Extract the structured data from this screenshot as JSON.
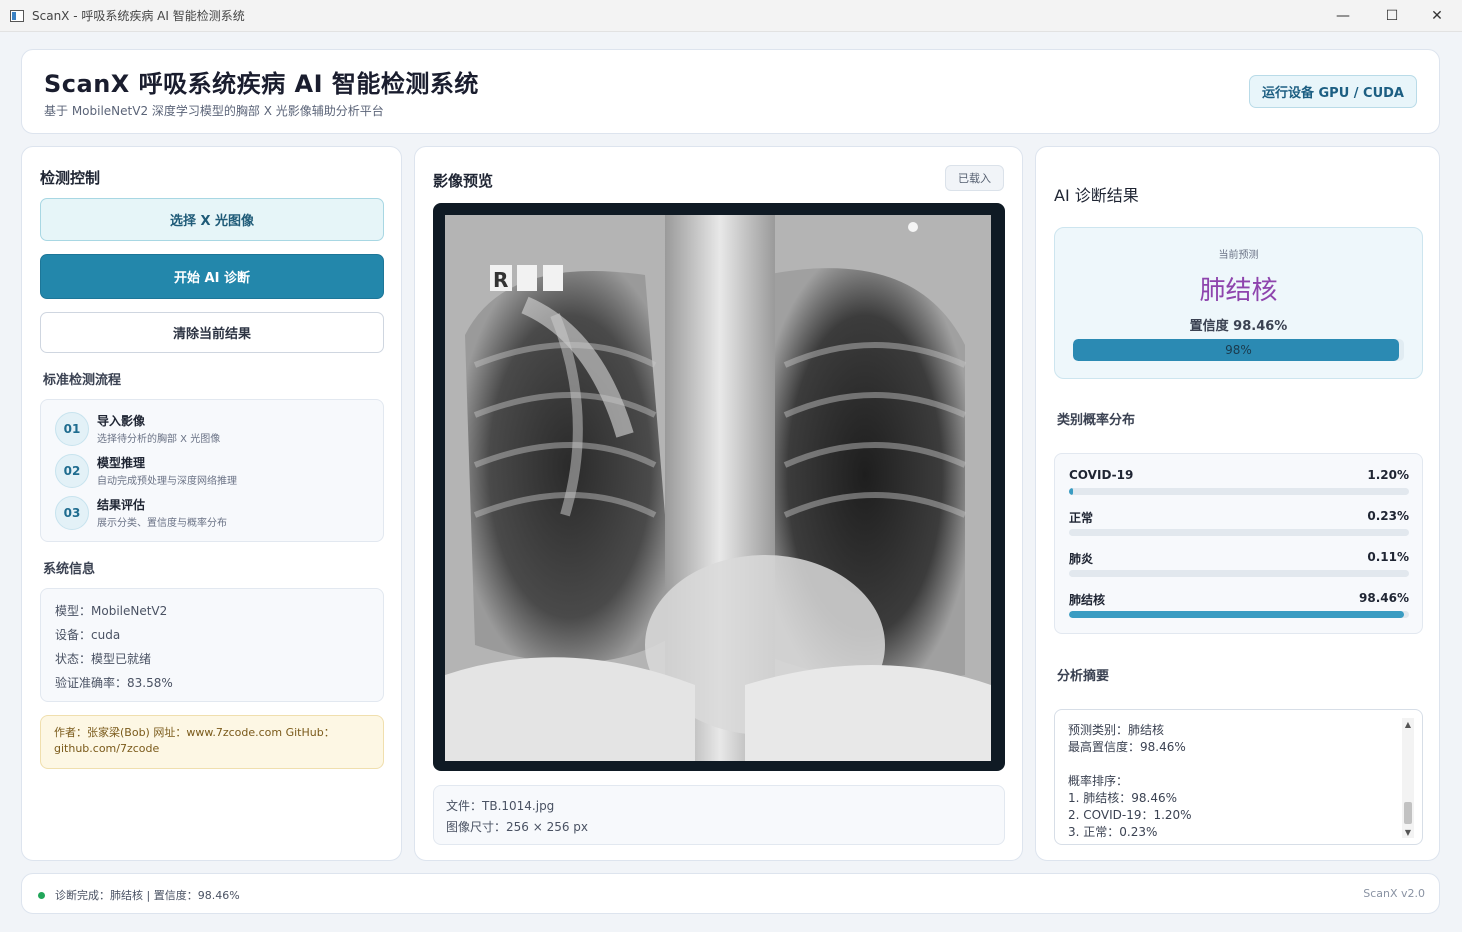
{
  "window": {
    "title": "ScanX - 呼吸系统疾病 AI 智能检测系统",
    "minimize": "—",
    "maximize": "☐",
    "close": "✕"
  },
  "header": {
    "title": "ScanX  呼吸系统疾病 AI 智能检测系统",
    "subtitle": "基于 MobileNetV2 深度学习模型的胸部 X 光影像辅助分析平台",
    "device_badge": "运行设备  GPU / CUDA"
  },
  "control": {
    "title": "检测控制",
    "select_button": "选择 X 光图像",
    "diagnose_button": "开始 AI 诊断",
    "clear_button": "清除当前结果",
    "workflow_title": "标准检测流程",
    "steps": [
      {
        "num": "01",
        "title": "导入影像",
        "desc": "选择待分析的胸部 X 光图像"
      },
      {
        "num": "02",
        "title": "模型推理",
        "desc": "自动完成预处理与深度网络推理"
      },
      {
        "num": "03",
        "title": "结果评估",
        "desc": "展示分类、置信度与概率分布"
      }
    ],
    "sysinfo_title": "系统信息",
    "sysinfo": [
      "模型：MobileNetV2",
      "设备：cuda",
      "状态：模型已就绪",
      "验证准确率：83.58%"
    ],
    "author": "作者：张家梁(Bob)  网址：www.7zcode.com GitHub：github.com/7zcode"
  },
  "preview": {
    "title": "影像预览",
    "loaded_badge": "已载入",
    "xray_marker": "R",
    "file_name": "文件：TB.1014.jpg",
    "image_size": "图像尺寸：256 × 256 px"
  },
  "result": {
    "title": "AI 诊断结果",
    "current_label": "当前预测",
    "prediction": "肺结核",
    "confidence_text": "置信度  98.46%",
    "confidence_value": 0.9846,
    "bar_label": "98%",
    "probs_title": "类别概率分布",
    "probs": [
      {
        "name": "COVID-19",
        "label": "1.20%",
        "value": 0.012
      },
      {
        "name": "正常",
        "label": "0.23%",
        "value": 0.0023
      },
      {
        "name": "肺炎",
        "label": "0.11%",
        "value": 0.0011
      },
      {
        "name": "肺结核",
        "label": "98.46%",
        "value": 0.9846
      }
    ],
    "summary_title": "分析摘要",
    "summary_text": "预测类别：肺结核\n最高置信度：98.46%\n\n概率排序：\n1. 肺结核：98.46%\n2. COVID-19：1.20%\n3. 正常：0.23%"
  },
  "status": {
    "message": "诊断完成：肺结核 | 置信度：98.46%",
    "version": "ScanX v2.0"
  }
}
